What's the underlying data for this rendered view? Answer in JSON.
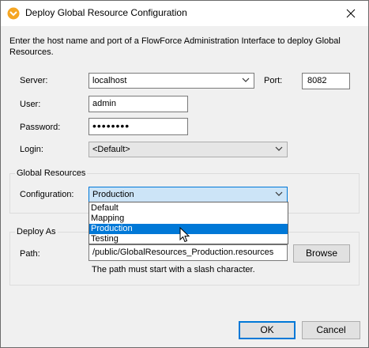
{
  "window": {
    "title": "Deploy Global Resource Configuration",
    "app_icon": "altova-icon",
    "close_icon": "close-icon"
  },
  "intro": "Enter the host name and port of a FlowForce Administration Interface to deploy Global Resources.",
  "server": {
    "label": "Server:",
    "value": "localhost"
  },
  "port": {
    "label": "Port:",
    "value": "8082"
  },
  "user": {
    "label": "User:",
    "value": "admin"
  },
  "password": {
    "label": "Password:",
    "value": "••••••••"
  },
  "login": {
    "label": "Login:",
    "value": "<Default>"
  },
  "global_resources": {
    "title": "Global Resources",
    "configuration_label": "Configuration:",
    "configuration_value": "Production",
    "options": [
      "Default",
      "Mapping",
      "Production",
      "Testing"
    ],
    "selected_index": 2
  },
  "deploy_as": {
    "title": "Deploy As",
    "path_label": "Path:",
    "path_value": "/public/GlobalResources_Production.resources",
    "browse_label": "Browse",
    "hint": "The path must start with a slash character."
  },
  "buttons": {
    "ok": "OK",
    "cancel": "Cancel"
  },
  "colors": {
    "selection": "#0078d7",
    "focus": "#cce4f7"
  }
}
